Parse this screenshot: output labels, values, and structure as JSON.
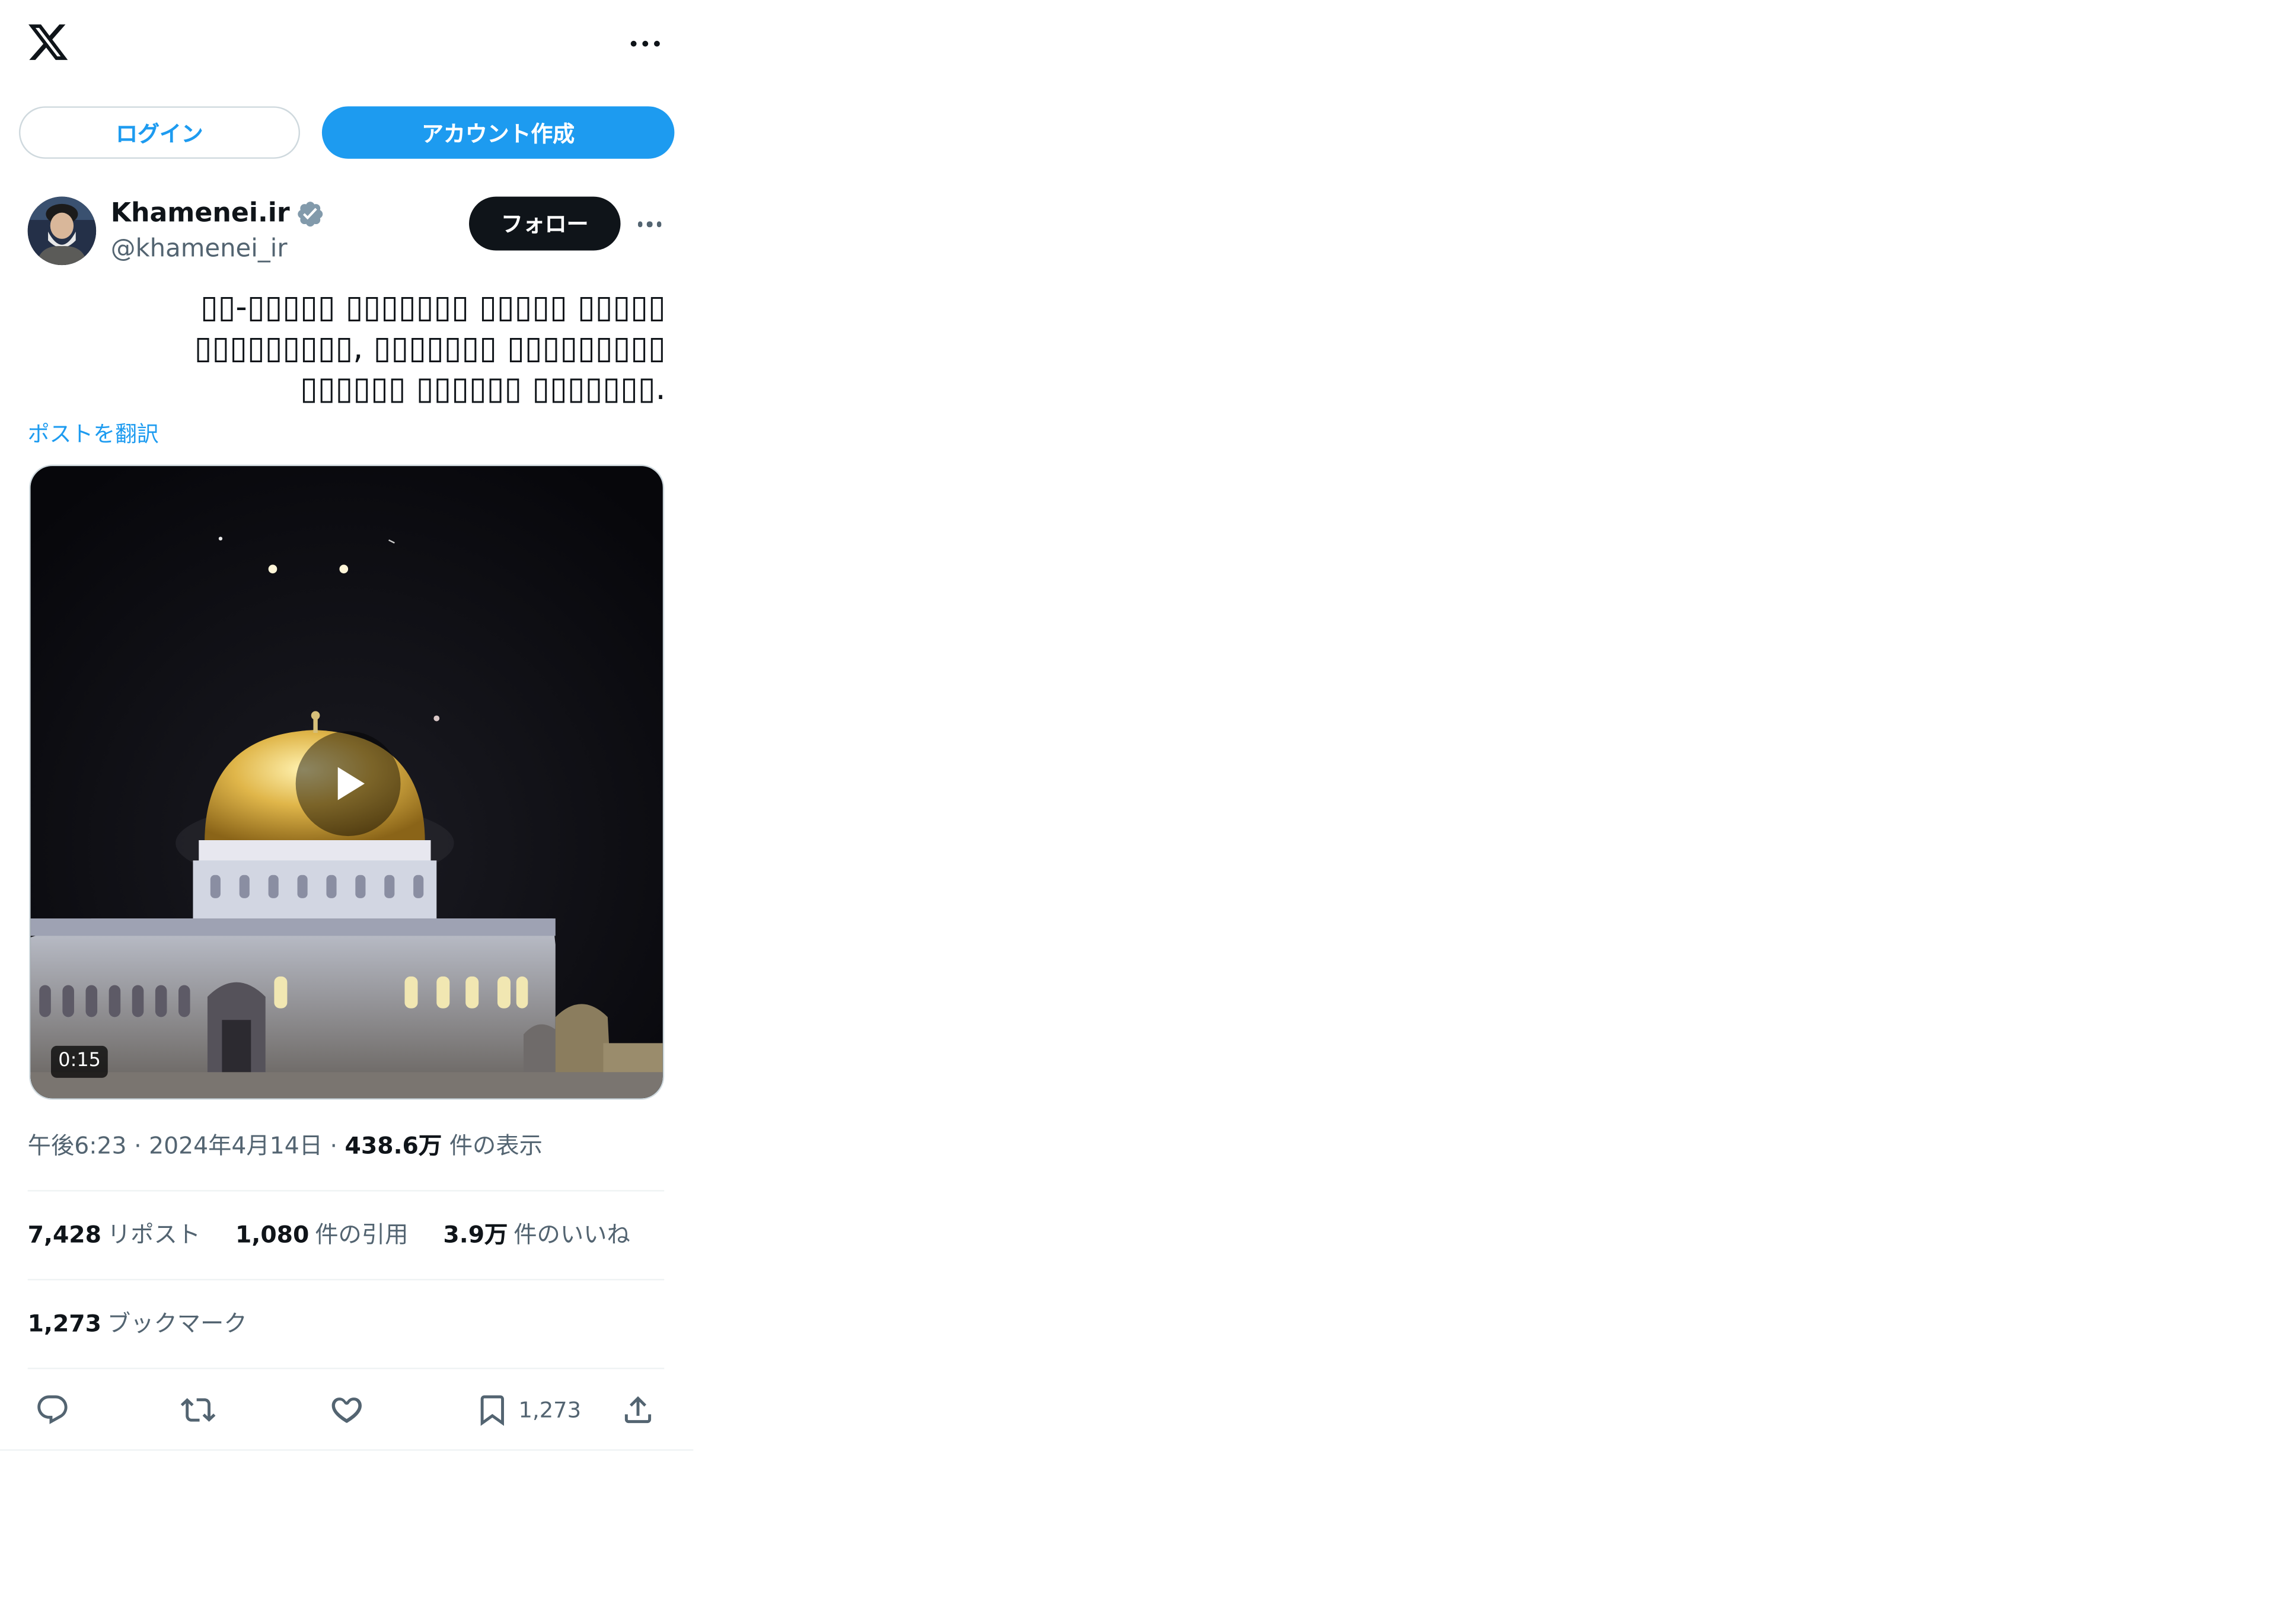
{
  "header": {
    "login_label": "ログイン",
    "signup_label": "アカウント作成"
  },
  "post": {
    "author_name": "Khamenei.ir",
    "author_handle": "@khamenei_ir",
    "follow_label": "フォロー",
    "text_lines": [
      "▯▯▯▯▯ ▯▯▯▯▯ ▯▯▯▯▯▯▯ ▯▯▯▯▯-▯▯",
      "▯▯▯▯▯▯▯▯▯ ▯▯▯▯▯▯▯ ,▯▯▯▯▯▯▯▯▯",
      ".▯▯▯▯▯▯▯ ▯▯▯▯▯▯ ▯▯▯▯▯▯"
    ],
    "translate_label": "ポストを翻訳",
    "video_duration": "0:15",
    "meta": {
      "time": "午後6:23",
      "date": "2024年4月14日",
      "views_count": "438.6万",
      "views_label": "件の表示"
    },
    "stats": {
      "reposts_count": "7,428",
      "reposts_label": "リポスト",
      "quotes_count": "1,080",
      "quotes_label": "件の引用",
      "likes_count": "3.9万",
      "likes_label": "件のいいね",
      "bookmarks_count": "1,273",
      "bookmarks_label": "ブックマーク"
    },
    "actions": {
      "bookmark_count": "1,273"
    }
  },
  "colors": {
    "accent": "#1d9bf0",
    "text_primary": "#0f1419",
    "text_secondary": "#536471",
    "follow_button": "#0f1419",
    "dome_gold": "#e0b64a"
  },
  "icons": [
    "x-logo-icon",
    "more-icon",
    "verified-icon",
    "play-icon",
    "reply-icon",
    "repost-icon",
    "like-icon",
    "bookmark-icon",
    "share-icon"
  ]
}
